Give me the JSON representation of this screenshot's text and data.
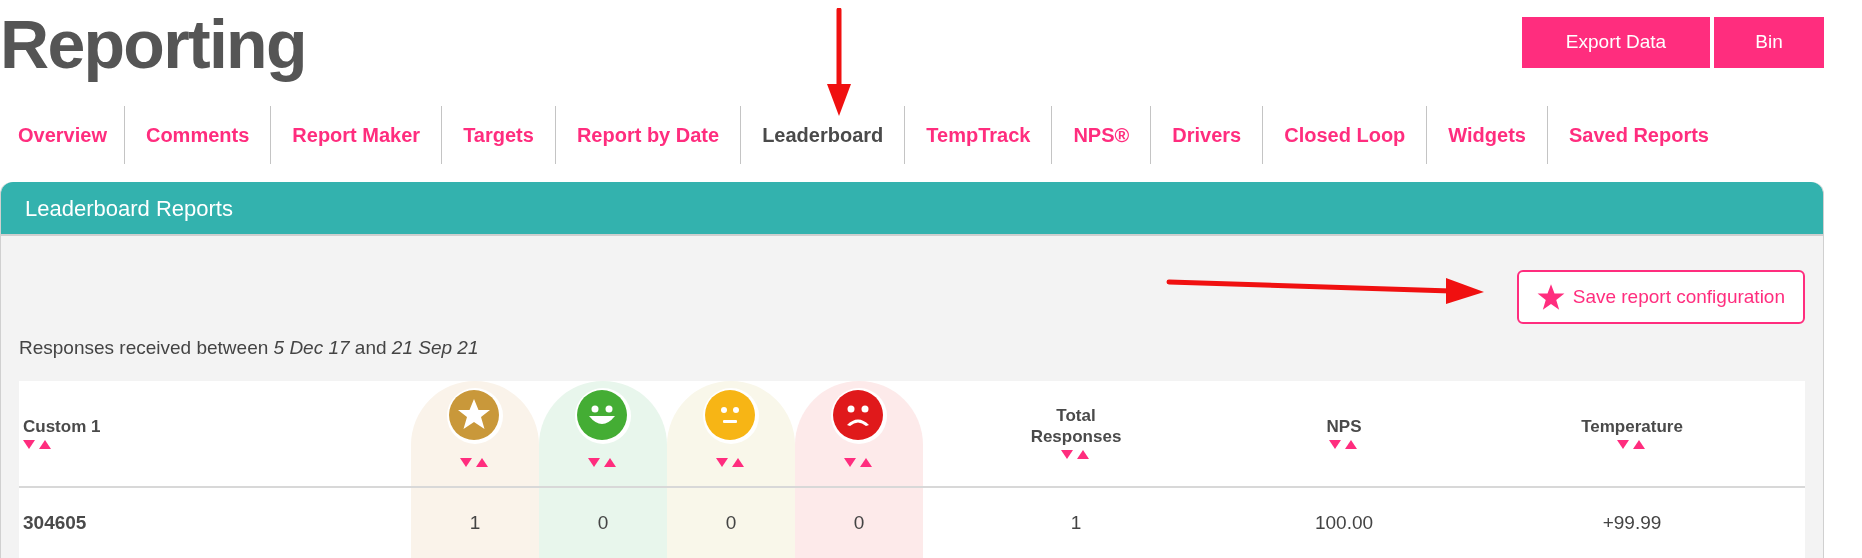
{
  "page": {
    "title": "Reporting"
  },
  "actions": [
    "Export Data",
    "Bin"
  ],
  "tabs": [
    {
      "label": "Overview",
      "selected": false
    },
    {
      "label": "Comments",
      "selected": false
    },
    {
      "label": "Report Maker",
      "selected": false
    },
    {
      "label": "Targets",
      "selected": false
    },
    {
      "label": "Report by Date",
      "selected": false
    },
    {
      "label": "Leaderboard",
      "selected": true
    },
    {
      "label": "TempTrack",
      "selected": false
    },
    {
      "label": "NPS®",
      "selected": false
    },
    {
      "label": "Drivers",
      "selected": false
    },
    {
      "label": "Closed Loop",
      "selected": false
    },
    {
      "label": "Widgets",
      "selected": false
    },
    {
      "label": "Saved Reports",
      "selected": false
    }
  ],
  "panel": {
    "title": "Leaderboard Reports",
    "save_button": "Save report configuration",
    "date_range": "Responses received between *5 Dec 17* and *21 Sep 21*"
  },
  "table": {
    "columns": [
      {
        "kind": "key",
        "label": "Custom 1"
      },
      {
        "kind": "star",
        "color": "#faf3ea"
      },
      {
        "kind": "happy",
        "color": "#e8f6ec"
      },
      {
        "kind": "neutral",
        "color": "#f9f7ea"
      },
      {
        "kind": "sad",
        "color": "#fdeaea"
      },
      {
        "kind": "metric",
        "label": "Total Responses"
      },
      {
        "kind": "metric",
        "label": "NPS"
      },
      {
        "kind": "metric",
        "label": "Temperature"
      }
    ],
    "rows": [
      {
        "cells": [
          "304605",
          "1",
          "0",
          "0",
          "0",
          "1",
          "100.00",
          "+99.99"
        ]
      }
    ]
  }
}
